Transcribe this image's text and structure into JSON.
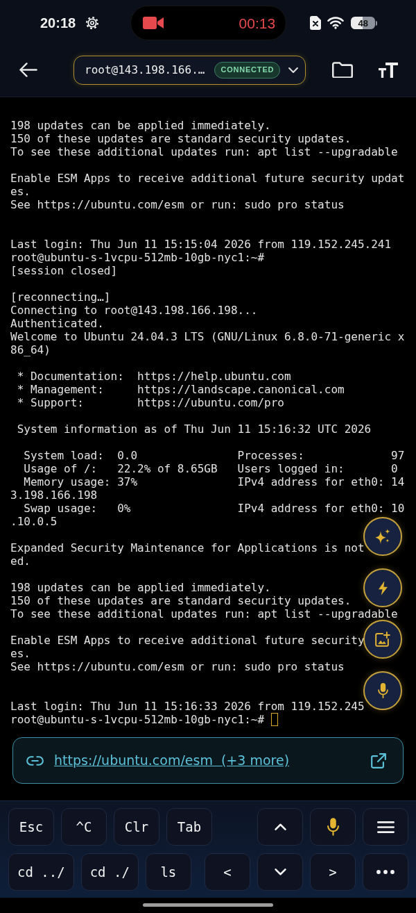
{
  "status_bar": {
    "time": "20:18",
    "recording_time": "00:13",
    "battery": "48"
  },
  "header": {
    "host": "root@143.198.166.…",
    "connection_status": "CONNECTED"
  },
  "terminal": {
    "rows": [
      {
        "kind": "output",
        "text": "198 updates can be applied immediately."
      },
      {
        "kind": "output",
        "text": "150 of these updates are standard security updates."
      },
      {
        "kind": "output",
        "text": "To see these additional updates run: apt list --upgradable"
      },
      {
        "kind": "blank"
      },
      {
        "kind": "output",
        "text": "Enable ESM Apps to receive additional future security updat"
      },
      {
        "kind": "output",
        "text": "es."
      },
      {
        "kind": "output",
        "text": "See https://ubuntu.com/esm or run: sudo pro status"
      },
      {
        "kind": "blank"
      },
      {
        "kind": "blank"
      },
      {
        "kind": "output",
        "text": "Last login: Thu Jun 11 15:15:04 2026 from 119.152.245.241"
      },
      {
        "kind": "output",
        "text": "root@ubuntu-s-1vcpu-512mb-10gb-nyc1:~#"
      },
      {
        "kind": "output",
        "text": "[session closed]"
      },
      {
        "kind": "blank"
      },
      {
        "kind": "output",
        "text": "[reconnecting…]"
      },
      {
        "kind": "output",
        "text": "Connecting to root@143.198.166.198..."
      },
      {
        "kind": "output",
        "text": "Authenticated."
      },
      {
        "kind": "output",
        "text": "Welcome to Ubuntu 24.04.3 LTS (GNU/Linux 6.8.0-71-generic x"
      },
      {
        "kind": "output",
        "text": "86_64)"
      },
      {
        "kind": "blank"
      },
      {
        "kind": "output",
        "text": " * Documentation:  https://help.ubuntu.com"
      },
      {
        "kind": "output",
        "text": " * Management:     https://landscape.canonical.com"
      },
      {
        "kind": "output",
        "text": " * Support:        https://ubuntu.com/pro"
      },
      {
        "kind": "blank"
      },
      {
        "kind": "output",
        "text": " System information as of Thu Jun 11 15:16:32 UTC 2026"
      },
      {
        "kind": "blank"
      },
      {
        "kind": "output",
        "text": "  System load:  0.0               Processes:             97"
      },
      {
        "kind": "output",
        "text": "  Usage of /:   22.2% of 8.65GB   Users logged in:       0"
      },
      {
        "kind": "output",
        "text": "  Memory usage: 37%               IPv4 address for eth0: 14"
      },
      {
        "kind": "output",
        "text": "3.198.166.198"
      },
      {
        "kind": "output",
        "text": "  Swap usage:   0%                IPv4 address for eth0: 10"
      },
      {
        "kind": "output",
        "text": ".10.0.5"
      },
      {
        "kind": "blank"
      },
      {
        "kind": "output",
        "text": "Expanded Security Maintenance for Applications is not"
      },
      {
        "kind": "output",
        "text": "ed."
      },
      {
        "kind": "blank"
      },
      {
        "kind": "output",
        "text": "198 updates can be applied immediately."
      },
      {
        "kind": "output",
        "text": "150 of these updates are standard security updates."
      },
      {
        "kind": "output",
        "text": "To see these additional updates run: apt list --upgradable"
      },
      {
        "kind": "blank"
      },
      {
        "kind": "output",
        "text": "Enable ESM Apps to receive additional future security"
      },
      {
        "kind": "output",
        "text": "es."
      },
      {
        "kind": "output",
        "text": "See https://ubuntu.com/esm or run: sudo pro status"
      },
      {
        "kind": "blank"
      },
      {
        "kind": "blank"
      },
      {
        "kind": "output",
        "text": "Last login: Thu Jun 11 15:16:33 2026 from 119.152.245"
      },
      {
        "kind": "output",
        "text": "root@ubuntu-s-1vcpu-512mb-10gb-nyc1:~#"
      }
    ],
    "cursor_visible": true
  },
  "link_bar": {
    "link": "https://ubuntu.com/esm  (+3 more)"
  },
  "keyboard": {
    "rows": [
      {
        "left": [
          {
            "kind": "text",
            "label": "Esc"
          },
          {
            "kind": "text",
            "label": "^C"
          },
          {
            "kind": "text",
            "label": "Clr"
          },
          {
            "kind": "text",
            "label": "Tab"
          }
        ],
        "right": [
          {
            "kind": "up"
          },
          {
            "kind": "mic"
          },
          {
            "kind": "menu"
          }
        ]
      },
      {
        "left": [
          {
            "kind": "text",
            "label": "cd ../"
          },
          {
            "kind": "text",
            "label": "cd ./"
          },
          {
            "kind": "text",
            "label": "ls"
          }
        ],
        "right": [
          {
            "kind": "text",
            "label": "<"
          },
          {
            "kind": "down"
          },
          {
            "kind": "text",
            "label": ">"
          },
          {
            "kind": "more"
          }
        ]
      }
    ]
  }
}
